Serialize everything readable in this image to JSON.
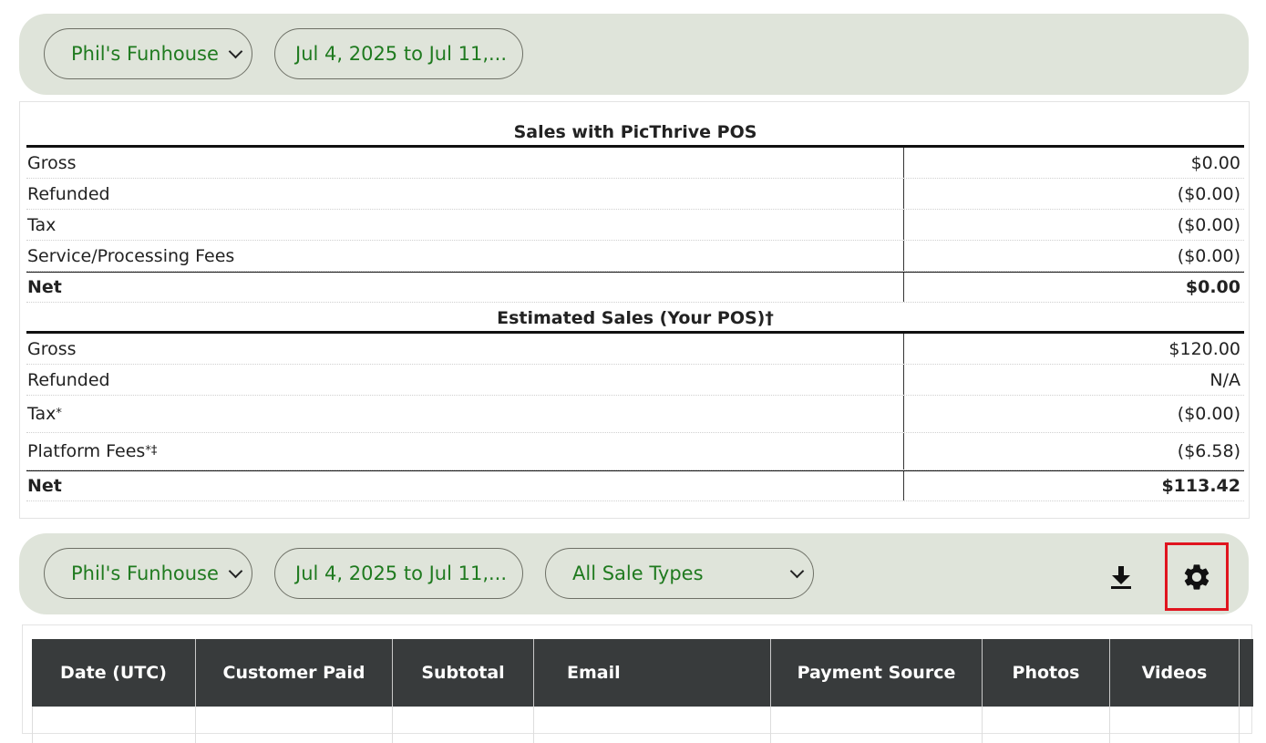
{
  "top_filters": {
    "location": "Phil's Funhouse",
    "date_range": "Jul 4, 2025 to Jul 11,..."
  },
  "summary": {
    "pos_section": {
      "title": "Sales with PicThrive POS",
      "rows": [
        {
          "label": "Gross",
          "value": "$0.00"
        },
        {
          "label": "Refunded",
          "value": "($0.00)"
        },
        {
          "label": "Tax",
          "value": "($0.00)"
        },
        {
          "label": "Service/Processing Fees",
          "value": "($0.00)"
        }
      ],
      "net": {
        "label": "Net",
        "value": "$0.00"
      }
    },
    "est_section": {
      "title": "Estimated Sales (Your POS)†",
      "rows": [
        {
          "label": "Gross",
          "value": "$120.00"
        },
        {
          "label": "Refunded",
          "value": "N/A"
        },
        {
          "label": "Tax",
          "sup": "*",
          "value": "($0.00)"
        },
        {
          "label": "Platform Fees",
          "sup": "*‡",
          "value": "($6.58)"
        }
      ],
      "net": {
        "label": "Net",
        "value": "$113.42"
      }
    }
  },
  "bottom_filters": {
    "location": "Phil's Funhouse",
    "date_range": "Jul 4, 2025 to Jul 11,...",
    "sale_type": "All Sale Types"
  },
  "icons": {
    "download": "download-icon",
    "settings": "gear-icon"
  },
  "table": {
    "columns": [
      "Date (UTC)",
      "Customer Paid",
      "Subtotal",
      "Email",
      "Payment Source",
      "Photos",
      "Videos"
    ]
  }
}
